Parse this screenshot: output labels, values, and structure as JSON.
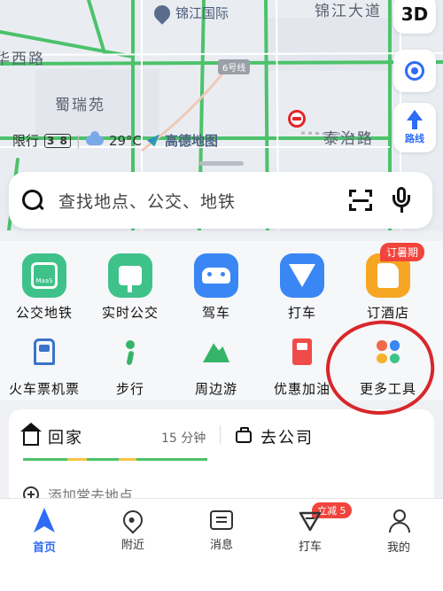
{
  "map": {
    "road_labels": [
      "锦江大道",
      "华西路",
      "泰治路",
      "蜀瑞苑"
    ],
    "poi_name": "锦江国际",
    "metro_line": "6号线",
    "controls": {
      "three_d": "3D",
      "route_label": "路线"
    },
    "status": {
      "restriction_prefix": "限行",
      "restriction_numbers": "3 8",
      "temperature": "29°C",
      "brand": "高德地图"
    }
  },
  "search": {
    "placeholder": "查找地点、公交、地铁"
  },
  "quick_tools": {
    "row1": [
      {
        "label": "公交地铁",
        "icon": "bus-icon",
        "color": "#3fc28a"
      },
      {
        "label": "实时公交",
        "icon": "realtime-bus-icon",
        "color": "#3fc28a"
      },
      {
        "label": "驾车",
        "icon": "car-icon",
        "color": "#3a86f5"
      },
      {
        "label": "打车",
        "icon": "taxi-icon",
        "color": "#3a86f5"
      },
      {
        "label": "订酒店",
        "icon": "hotel-icon",
        "color": "#f6a623",
        "badge": "订暑期"
      }
    ],
    "row2": [
      {
        "label": "火车票机票",
        "icon": "train-icon"
      },
      {
        "label": "步行",
        "icon": "walk-icon"
      },
      {
        "label": "周边游",
        "icon": "nearby-tour-icon"
      },
      {
        "label": "优惠加油",
        "icon": "fuel-icon"
      },
      {
        "label": "更多工具",
        "icon": "more-tools-icon"
      }
    ]
  },
  "commute": {
    "home_label": "回家",
    "home_eta": "15 分钟",
    "work_label": "去公司",
    "add_place": "添加常去地点"
  },
  "tabs": [
    {
      "label": "首页",
      "icon": "navigation-arrow-icon",
      "active": true
    },
    {
      "label": "附近",
      "icon": "location-pin-icon"
    },
    {
      "label": "消息",
      "icon": "message-icon"
    },
    {
      "label": "打车",
      "icon": "taxi-tab-icon",
      "badge": "立减 5"
    },
    {
      "label": "我的",
      "icon": "user-icon"
    }
  ],
  "colors": {
    "accent": "#2f6cf6",
    "alert": "#f0443c",
    "road_green": "#4cc26b"
  }
}
